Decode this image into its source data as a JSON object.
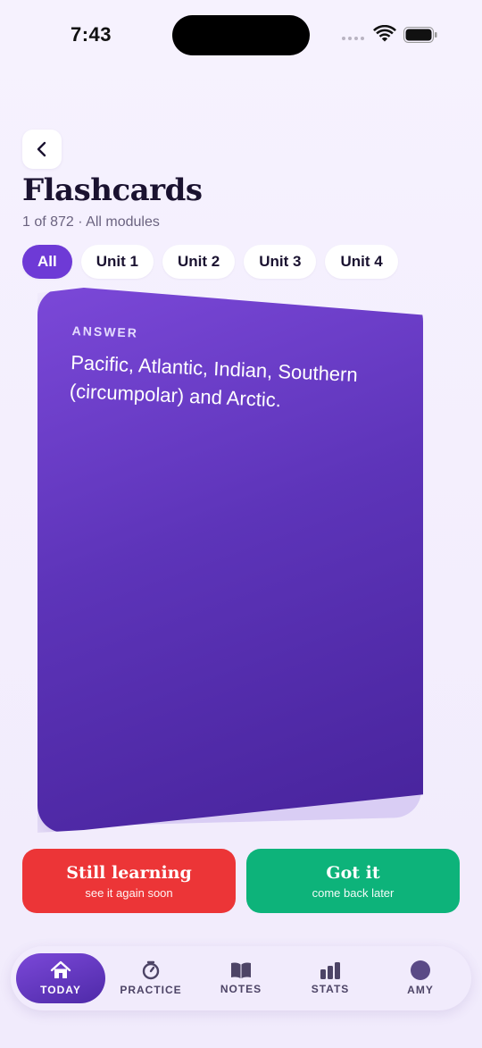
{
  "status": {
    "time": "7:43"
  },
  "header": {
    "title": "Flashcards",
    "subtitle": "1 of 872 · All modules"
  },
  "filters": [
    {
      "label": "All",
      "active": true
    },
    {
      "label": "Unit 1",
      "active": false
    },
    {
      "label": "Unit 2",
      "active": false
    },
    {
      "label": "Unit 3",
      "active": false
    },
    {
      "label": "Unit 4",
      "active": false
    }
  ],
  "card": {
    "label": "ANSWER",
    "text": "Pacific, Atlantic, Indian, Southern (circumpolar) and Arctic."
  },
  "actions": {
    "learning": {
      "title": "Still learning",
      "subtitle": "see it again soon"
    },
    "got": {
      "title": "Got it",
      "subtitle": "come back later"
    }
  },
  "tabs": [
    {
      "label": "TODAY",
      "icon": "home-icon",
      "active": true
    },
    {
      "label": "PRACTICE",
      "icon": "timer-icon",
      "active": false
    },
    {
      "label": "NOTES",
      "icon": "book-icon",
      "active": false
    },
    {
      "label": "STATS",
      "icon": "bar-chart-icon",
      "active": false
    },
    {
      "label": "AMY",
      "icon": "avatar",
      "active": false
    }
  ],
  "colors": {
    "accent": "#6e3ad6",
    "learning": "#ec3537",
    "got": "#0db37a"
  }
}
